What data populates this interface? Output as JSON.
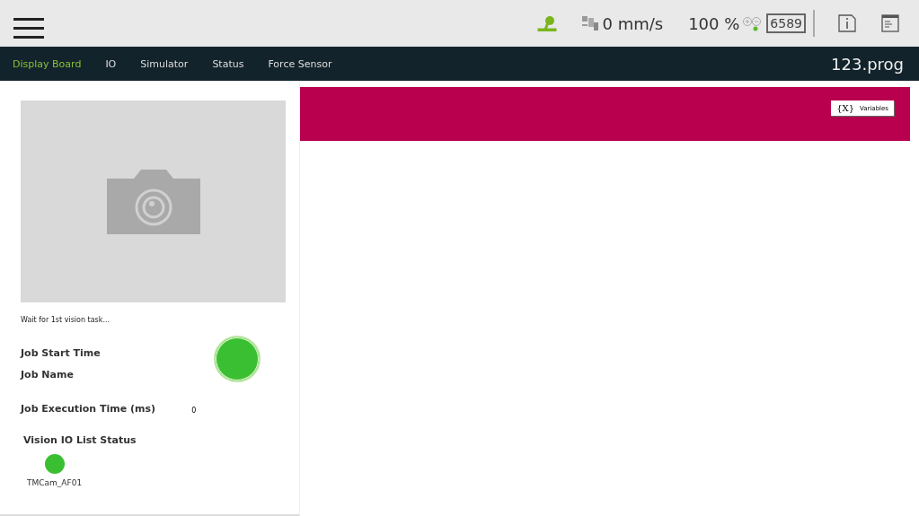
{
  "top_bar": {
    "speed": "0 mm/s",
    "percent": "100 %",
    "counter": "6589"
  },
  "tabs": [
    {
      "label": "Display Board",
      "selected": true
    },
    {
      "label": "IO",
      "selected": false
    },
    {
      "label": "Simulator",
      "selected": false
    },
    {
      "label": "Status",
      "selected": false
    },
    {
      "label": "Force Sensor",
      "selected": false
    }
  ],
  "program_name": "123.prog",
  "vision": {
    "message": "Wait for 1st vision task...",
    "job_ok": true,
    "fields": [
      {
        "label": "Job Start Time"
      },
      {
        "label": "Job Name"
      },
      {
        "label": "Job Execution Time (ms)",
        "value": "0"
      }
    ],
    "io_heading": "Vision IO List Status",
    "io_list": [
      {
        "name": "TMCam_AF01",
        "color": "#3bbf32"
      }
    ]
  },
  "variables_button": {
    "icon_text": "{X}",
    "label": "Variables"
  }
}
